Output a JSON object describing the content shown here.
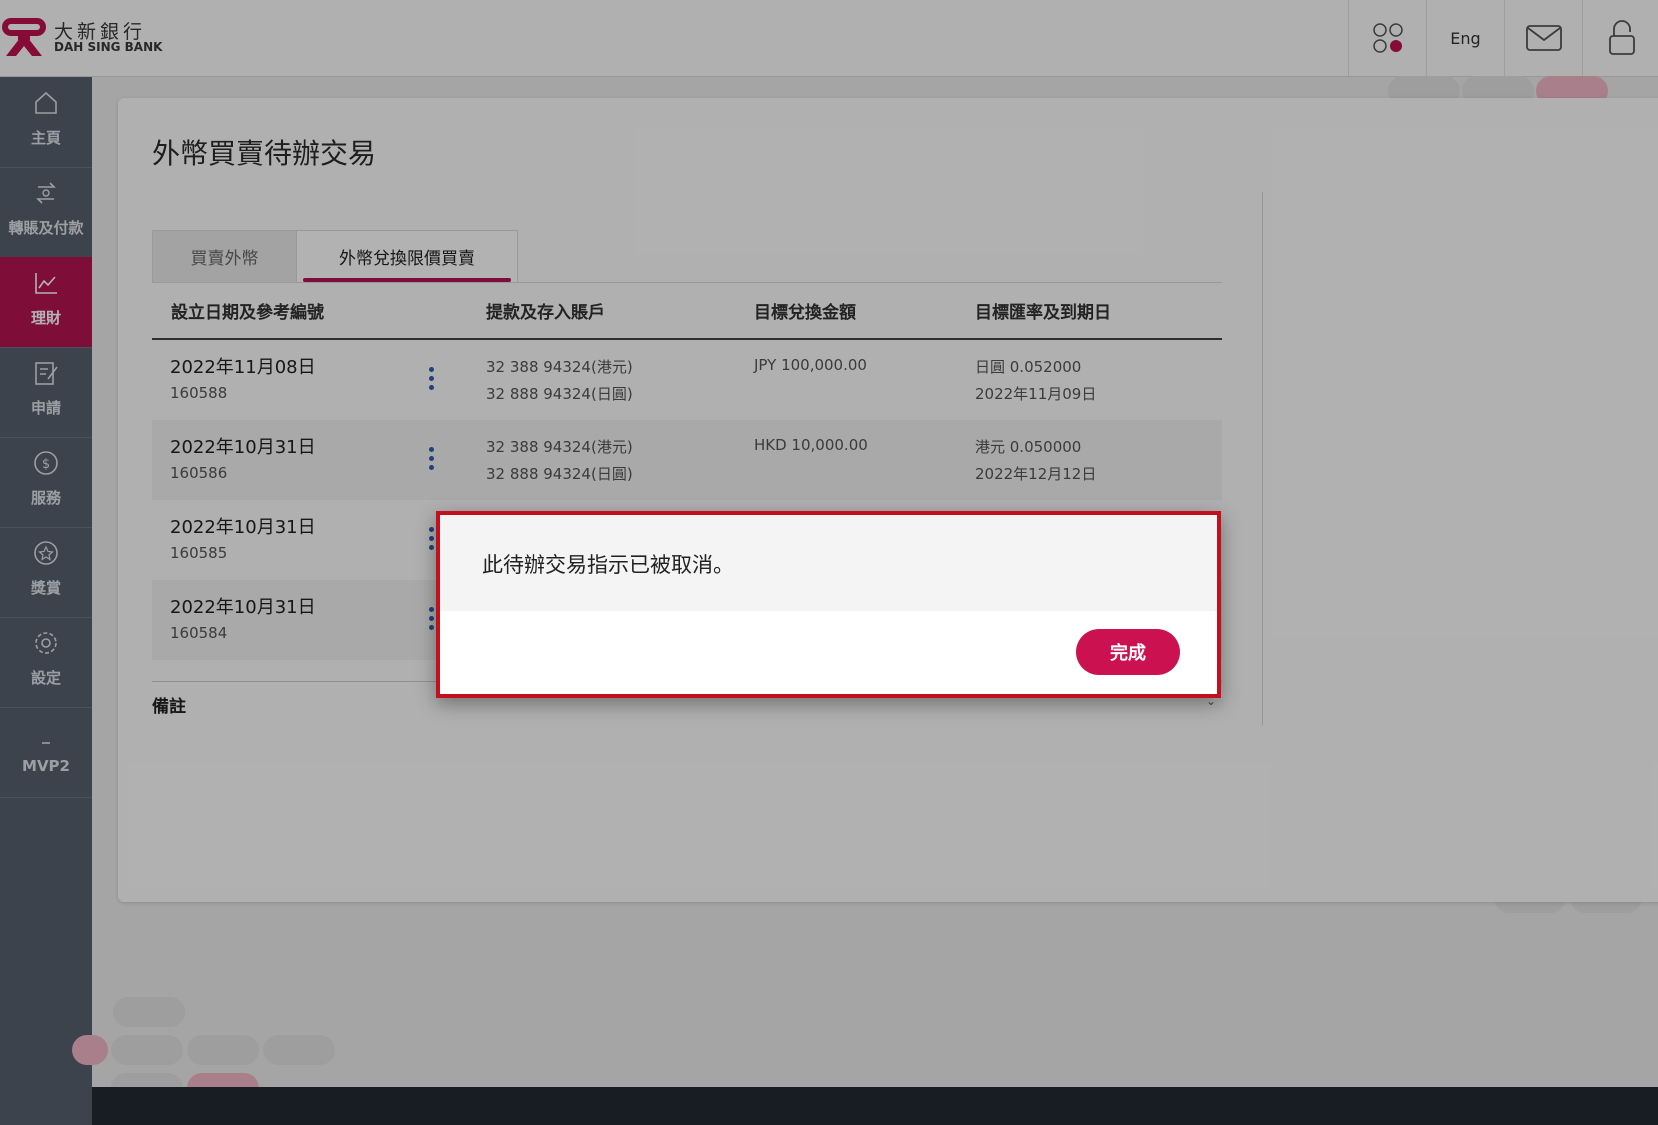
{
  "brand": {
    "name_cn": "大新銀行",
    "name_en": "DAH SING BANK",
    "colors": {
      "accent": "#b5134f",
      "sidebar": "#56616f",
      "modal_border": "#c3101f"
    }
  },
  "header": {
    "apps_icon": "apps-grid-icon",
    "language_label": "Eng",
    "mail_icon": "mail-icon",
    "lock_icon": "lock-icon"
  },
  "sidebar": {
    "items": [
      {
        "label": "主頁",
        "icon": "home-icon",
        "active": false
      },
      {
        "label": "轉賬及付款",
        "icon": "transfer-icon",
        "active": false
      },
      {
        "label": "理財",
        "icon": "chart-icon",
        "active": true
      },
      {
        "label": "申請",
        "icon": "form-icon",
        "active": false
      },
      {
        "label": "服務",
        "icon": "dollar-icon",
        "active": false
      },
      {
        "label": "獎賞",
        "icon": "star-icon",
        "active": false
      },
      {
        "label": "設定",
        "icon": "gear-icon",
        "active": false
      },
      {
        "label": "MVP2",
        "icon": "dash-icon",
        "active": false
      }
    ]
  },
  "main": {
    "title": "外幣買賣待辦交易",
    "tabs": [
      {
        "label": "買賣外幣",
        "active": false
      },
      {
        "label": "外幣兌換限價買賣",
        "active": true
      }
    ],
    "columns": [
      "設立日期及參考編號",
      "提款及存入賬戶",
      "目標兌換金額",
      "目標匯率及到期日"
    ],
    "rows": [
      {
        "date": "2022年11月08日",
        "ref": "160588",
        "from_account": "32 388 94324(港元)",
        "to_account": "32 888 94324(日圓)",
        "amount": "JPY 100,000.00",
        "rate": "日圓 0.052000",
        "expiry": "2022年11月09日"
      },
      {
        "date": "2022年10月31日",
        "ref": "160586",
        "from_account": "32 388 94324(港元)",
        "to_account": "32 888 94324(日圓)",
        "amount": "HKD 10,000.00",
        "rate": "港元 0.050000",
        "expiry": "2022年12月12日"
      },
      {
        "date": "2022年10月31日",
        "ref": "160585"
      },
      {
        "date": "2022年10月31日",
        "ref": "160584"
      }
    ],
    "remarks_label": "備註"
  },
  "modal": {
    "message": "此待辦交易指示已被取消。",
    "confirm_label": "完成"
  }
}
